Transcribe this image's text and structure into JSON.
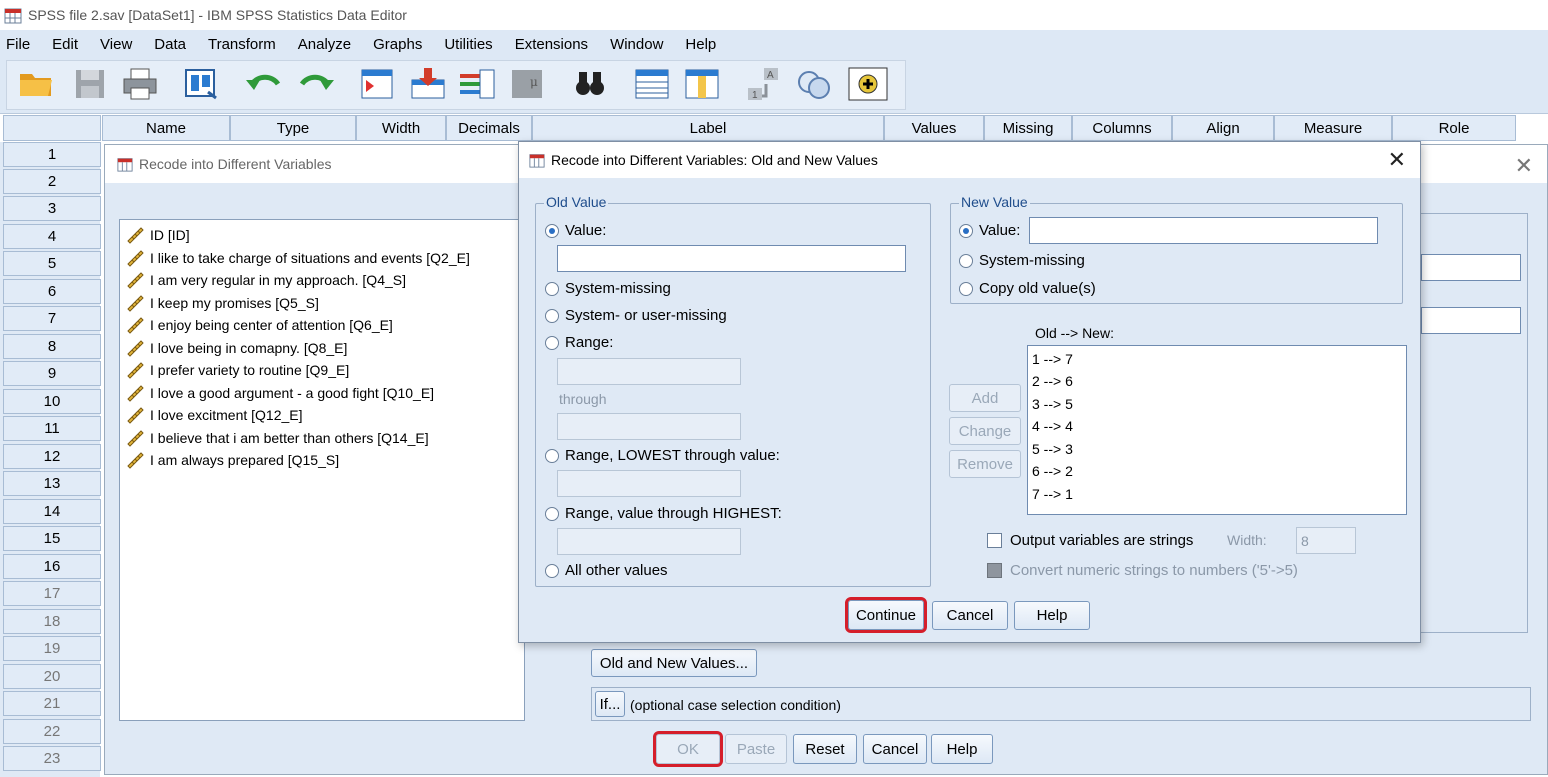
{
  "window": {
    "title": "SPSS file 2.sav [DataSet1] - IBM SPSS Statistics Data Editor"
  },
  "menu": [
    "File",
    "Edit",
    "View",
    "Data",
    "Transform",
    "Analyze",
    "Graphs",
    "Utilities",
    "Extensions",
    "Window",
    "Help"
  ],
  "toolbar_icons": [
    "open-icon",
    "save-icon",
    "print-icon",
    "dialog-recall-icon",
    "undo-icon",
    "redo-icon",
    "goto-case-icon",
    "goto-variable-icon",
    "variables-icon",
    "run-descriptives-icon",
    "find-icon",
    "insert-cases-icon",
    "insert-variable-icon",
    "split-file-icon",
    "value-labels-icon",
    "use-sets-icon",
    "customize-icon"
  ],
  "grid": {
    "columns": [
      "Name",
      "Type",
      "Width",
      "Decimals",
      "Label",
      "Values",
      "Missing",
      "Columns",
      "Align",
      "Measure",
      "Role"
    ],
    "rows": [
      "1",
      "2",
      "3",
      "4",
      "5",
      "6",
      "7",
      "8",
      "9",
      "10",
      "11",
      "12",
      "13",
      "14",
      "15",
      "16",
      "17",
      "18",
      "19",
      "20",
      "21",
      "22",
      "23"
    ]
  },
  "back_dialog": {
    "title": "Recode into Different Variables",
    "variables": [
      "ID [ID]",
      "I like to take charge of situations and events [Q2_E]",
      "I am very regular in my approach. [Q4_S]",
      "I keep my promises [Q5_S]",
      "I enjoy being center of attention [Q6_E]",
      "I love being in comapny. [Q8_E]",
      "I prefer variety to routine [Q9_E]",
      "I love a good argument - a good fight [Q10_E]",
      "I love excitment [Q12_E]",
      "I believe that i am better than others  [Q14_E]",
      "I am always prepared [Q15_S]"
    ],
    "old_new_button": "Old and New Values...",
    "if_button": "If...",
    "if_text": "(optional case selection condition)",
    "buttons": {
      "ok": "OK",
      "paste": "Paste",
      "reset": "Reset",
      "cancel": "Cancel",
      "help": "Help"
    }
  },
  "dialog": {
    "title": "Recode into Different Variables: Old and New Values",
    "old_value": {
      "legend": "Old Value",
      "value_label": "Value:",
      "value": "",
      "system_missing": "System-missing",
      "system_or_user_missing": "System- or user-missing",
      "range": "Range:",
      "through": "through",
      "range_lowest": "Range, LOWEST through value:",
      "range_highest": "Range, value through HIGHEST:",
      "all_other": "All other values",
      "selected": "value"
    },
    "new_value": {
      "legend": "New Value",
      "value_label": "Value:",
      "value": "",
      "system_missing": "System-missing",
      "copy_old": "Copy old value(s)",
      "selected": "value"
    },
    "mapping_label": "Old --> New:",
    "mappings": [
      "1 --> 7",
      "2 --> 6",
      "3 --> 5",
      "4 --> 4",
      "5 --> 3",
      "6 --> 2",
      "7 --> 1"
    ],
    "add": "Add",
    "change": "Change",
    "remove": "Remove",
    "output_strings": {
      "label": "Output variables are strings",
      "checked": false
    },
    "width_label": "Width:",
    "width_value": "8",
    "convert_numeric": {
      "label": "Convert numeric strings to numbers ('5'->5)",
      "checked": false
    },
    "buttons": {
      "continue": "Continue",
      "cancel": "Cancel",
      "help": "Help"
    }
  }
}
